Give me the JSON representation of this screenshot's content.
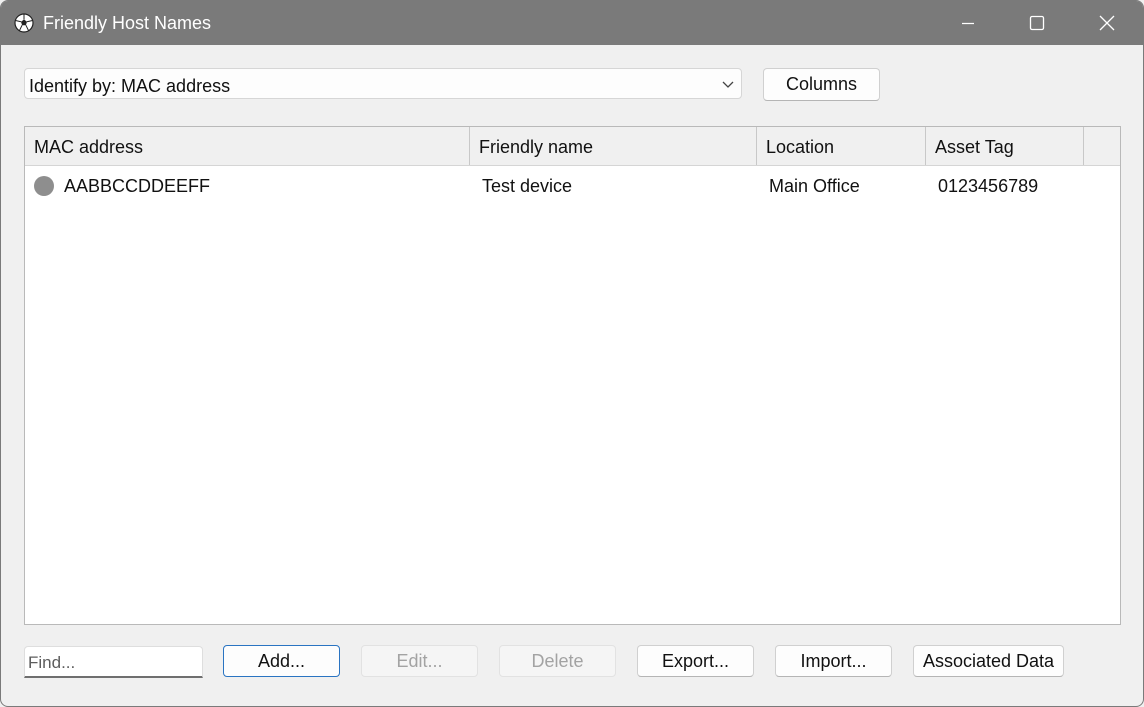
{
  "window": {
    "title": "Friendly Host Names"
  },
  "identify": {
    "selected": "Identify by: MAC address"
  },
  "toolbar": {
    "columns_label": "Columns"
  },
  "table": {
    "headers": [
      "MAC address",
      "Friendly name",
      "Location",
      "Asset Tag"
    ],
    "rows": [
      {
        "mac": "AABBCCDDEEFF",
        "friendly_name": "Test device",
        "location": "Main Office",
        "asset_tag": "0123456789",
        "status_color": "#8e8e8e"
      }
    ]
  },
  "footer": {
    "find_placeholder": "Find...",
    "add_label": "Add...",
    "edit_label": "Edit...",
    "delete_label": "Delete",
    "export_label": "Export...",
    "import_label": "Import...",
    "associated_label": "Associated Data"
  },
  "colors": {
    "titlebar": "#7a7a7a",
    "default_button_border": "#2a74c2"
  },
  "icons": {
    "app": "soccer-ball-icon",
    "minimize": "minimize-icon",
    "maximize": "maximize-icon",
    "close": "close-icon",
    "dropdown": "chevron-down-icon",
    "row_status": "status-dot-icon"
  }
}
